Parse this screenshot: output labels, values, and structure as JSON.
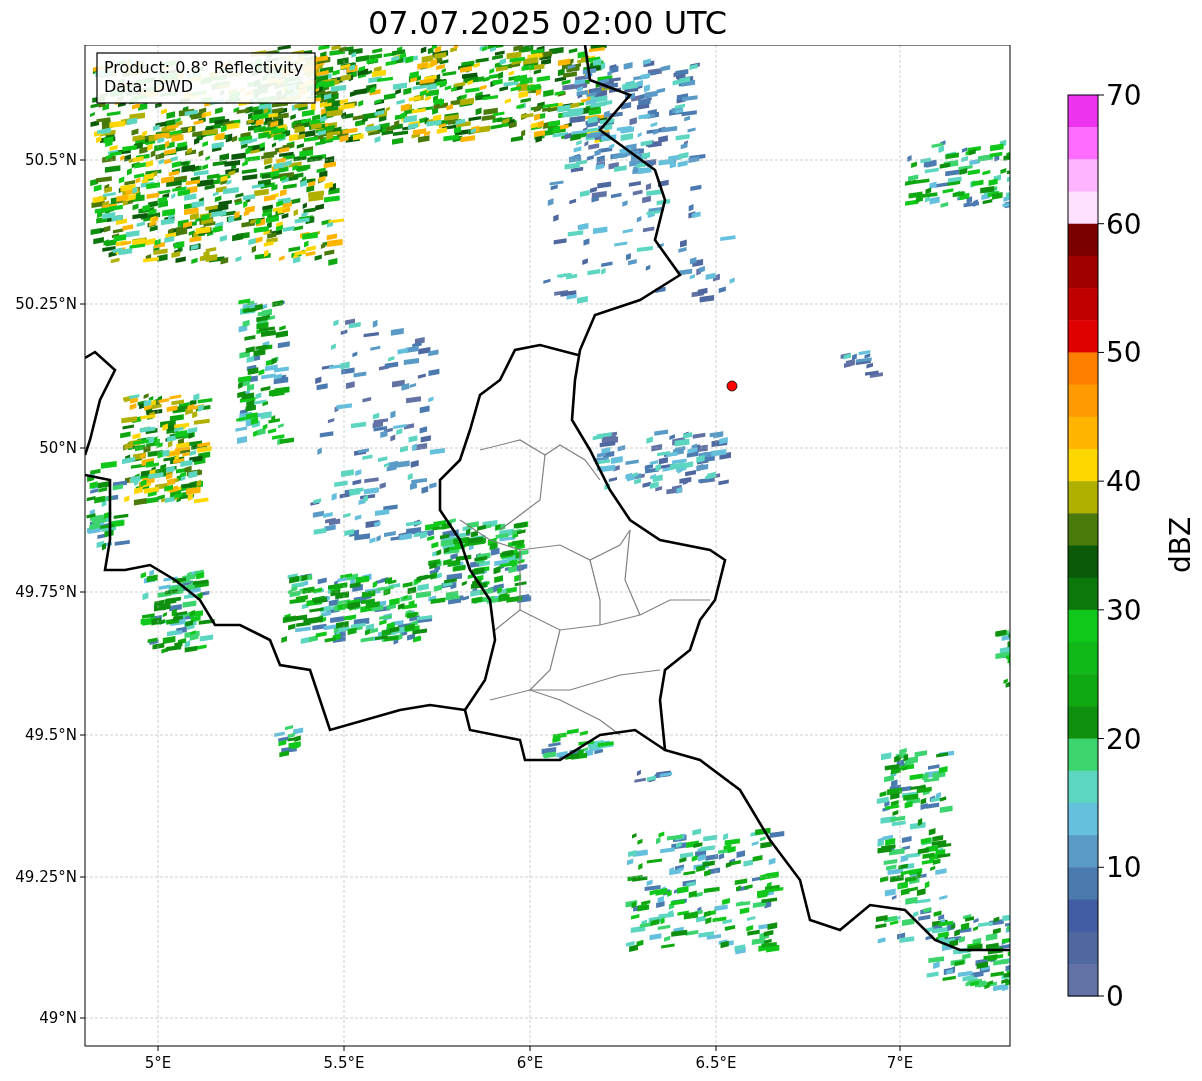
{
  "title": "07.07.2025 02:00 UTC",
  "map": {
    "info_box": [
      "Product: 0.8° Reflectivity",
      "Data: DWD"
    ],
    "y_ticks": [
      "50.5°N",
      "50.25°N",
      "50°N",
      "49.75°N",
      "49.5°N",
      "49.25°N",
      "49°N"
    ],
    "x_ticks": [
      "5°E",
      "5.5°E",
      "6°E",
      "6.5°E",
      "7°E"
    ]
  },
  "colorbar": {
    "label": "dBZ",
    "ticks": [
      "70",
      "60",
      "50",
      "40",
      "30",
      "20",
      "10",
      "0"
    ],
    "segments": [
      {
        "color": "#ee33ee"
      },
      {
        "color": "#ff6cff"
      },
      {
        "color": "#ffb4ff"
      },
      {
        "color": "#ffe0ff"
      },
      {
        "color": "#7a0000"
      },
      {
        "color": "#a00000"
      },
      {
        "color": "#c00000"
      },
      {
        "color": "#e00000"
      },
      {
        "color": "#ff8000"
      },
      {
        "color": "#ff9a00"
      },
      {
        "color": "#ffb400"
      },
      {
        "color": "#ffd700"
      },
      {
        "color": "#b0b000"
      },
      {
        "color": "#4a7a0a"
      },
      {
        "color": "#0a5a0a"
      },
      {
        "color": "#0c780c"
      },
      {
        "color": "#10c81a"
      },
      {
        "color": "#10b818"
      },
      {
        "color": "#10a810"
      },
      {
        "color": "#0e900e"
      },
      {
        "color": "#3cd46c"
      },
      {
        "color": "#5cd6c0"
      },
      {
        "color": "#64c0dc"
      },
      {
        "color": "#5a9ac6"
      },
      {
        "color": "#4a7ab0"
      },
      {
        "color": "#425da3"
      },
      {
        "color": "#5068a0"
      },
      {
        "color": "#6272a4"
      }
    ]
  }
}
